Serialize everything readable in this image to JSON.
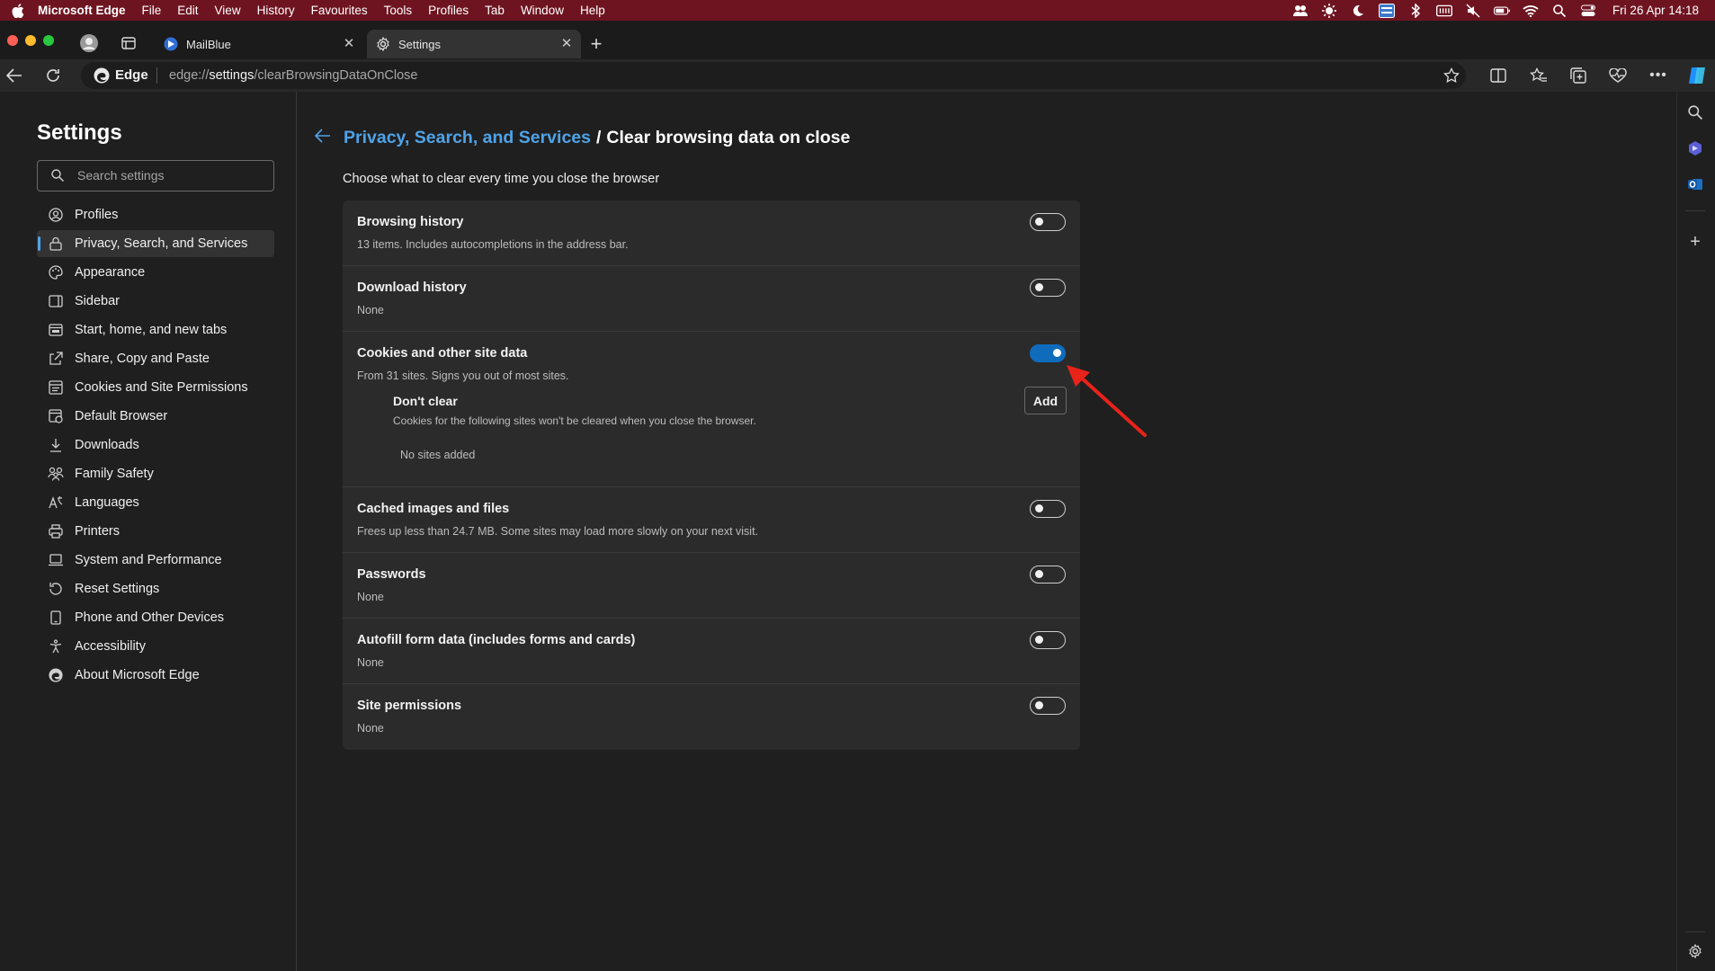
{
  "menubar": {
    "app_name": "Microsoft Edge",
    "menus": [
      "File",
      "Edit",
      "View",
      "History",
      "Favourites",
      "Tools",
      "Profiles",
      "Tab",
      "Window",
      "Help"
    ],
    "clock": "Fri 26 Apr  14:18",
    "status_icons": [
      "people-icon",
      "brightness-icon",
      "moon-icon",
      "keyboard-icon",
      "bluetooth-icon",
      "display-icon",
      "mute-icon",
      "battery-icon",
      "wifi-icon",
      "spotlight-icon",
      "control-center-icon"
    ]
  },
  "tabs": [
    {
      "label": "MailBlue",
      "active": false
    },
    {
      "label": "Settings",
      "active": true
    }
  ],
  "address": {
    "site_label": "Edge",
    "url_prefix": "edge://",
    "url_bold": "settings",
    "url_rest": "/clearBrowsingDataOnClose"
  },
  "sidebar": {
    "title": "Settings",
    "search_placeholder": "Search settings",
    "items": [
      {
        "label": "Profiles",
        "icon": "profile-icon"
      },
      {
        "label": "Privacy, Search, and Services",
        "icon": "lock-icon",
        "active": true
      },
      {
        "label": "Appearance",
        "icon": "appearance-icon"
      },
      {
        "label": "Sidebar",
        "icon": "sidebar-icon"
      },
      {
        "label": "Start, home, and new tabs",
        "icon": "home-tabs-icon"
      },
      {
        "label": "Share, Copy and Paste",
        "icon": "share-icon"
      },
      {
        "label": "Cookies and Site Permissions",
        "icon": "site-permissions-icon"
      },
      {
        "label": "Default Browser",
        "icon": "default-browser-icon"
      },
      {
        "label": "Downloads",
        "icon": "download-icon"
      },
      {
        "label": "Family Safety",
        "icon": "family-icon"
      },
      {
        "label": "Languages",
        "icon": "languages-icon"
      },
      {
        "label": "Printers",
        "icon": "printer-icon"
      },
      {
        "label": "System and Performance",
        "icon": "laptop-icon"
      },
      {
        "label": "Reset Settings",
        "icon": "reset-icon"
      },
      {
        "label": "Phone and Other Devices",
        "icon": "phone-icon"
      },
      {
        "label": "Accessibility",
        "icon": "accessibility-icon"
      },
      {
        "label": "About Microsoft Edge",
        "icon": "edge-logo-icon"
      }
    ]
  },
  "main": {
    "breadcrumb_link": "Privacy, Search, and Services",
    "breadcrumb_sep": "/",
    "breadcrumb_current": "Clear browsing data on close",
    "instruction": "Choose what to clear every time you close the browser",
    "rows": [
      {
        "title": "Browsing history",
        "desc": "13 items. Includes autocompletions in the address bar.",
        "enabled": false
      },
      {
        "title": "Download history",
        "desc": "None",
        "enabled": false
      },
      {
        "title": "Cookies and other site data",
        "desc": "From 31 sites. Signs you out of most sites.",
        "enabled": true
      },
      {
        "title": "Cached images and files",
        "desc": "Frees up less than 24.7 MB. Some sites may load more slowly on your next visit.",
        "enabled": false
      },
      {
        "title": "Passwords",
        "desc": "None",
        "enabled": false
      },
      {
        "title": "Autofill form data (includes forms and cards)",
        "desc": "None",
        "enabled": false
      },
      {
        "title": "Site permissions",
        "desc": "None",
        "enabled": false
      }
    ],
    "dont_clear": {
      "title": "Don't clear",
      "desc": "Cookies for the following sites won't be cleared when you close the browser.",
      "add_label": "Add",
      "empty_text": "No sites added"
    }
  },
  "colors": {
    "accent": "#4fa3e8",
    "toggle_on": "#0f6cbd",
    "menubar": "#6e1420",
    "annotation": "#e8231a"
  }
}
